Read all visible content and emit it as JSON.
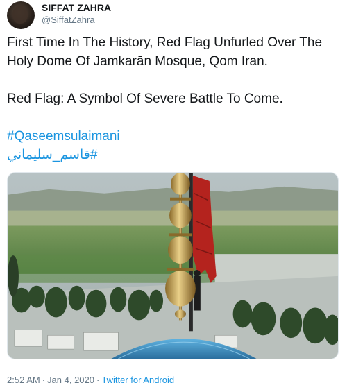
{
  "author": {
    "display_name": "SIFFAT ZAHRA",
    "handle": "@SiffatZahra"
  },
  "tweet": {
    "line1": "First Time In The History, Red Flag Unfurled Over The Holy Dome Of Jamkarān Mosque, Qom Iran.",
    "line2": "Red Flag: A Symbol Of Severe Battle To Come.",
    "hashtag_en": "#Qaseemsulaimani",
    "hashtag_ar": "#قاسم_سليماني"
  },
  "footer": {
    "time": "2:52 AM",
    "separator": "·",
    "date": "Jan 4, 2020",
    "source": "Twitter for Android"
  },
  "colors": {
    "link": "#1b95e0",
    "muted": "#657786",
    "flag": "#b4231e",
    "dome": "#3d8fc4"
  }
}
